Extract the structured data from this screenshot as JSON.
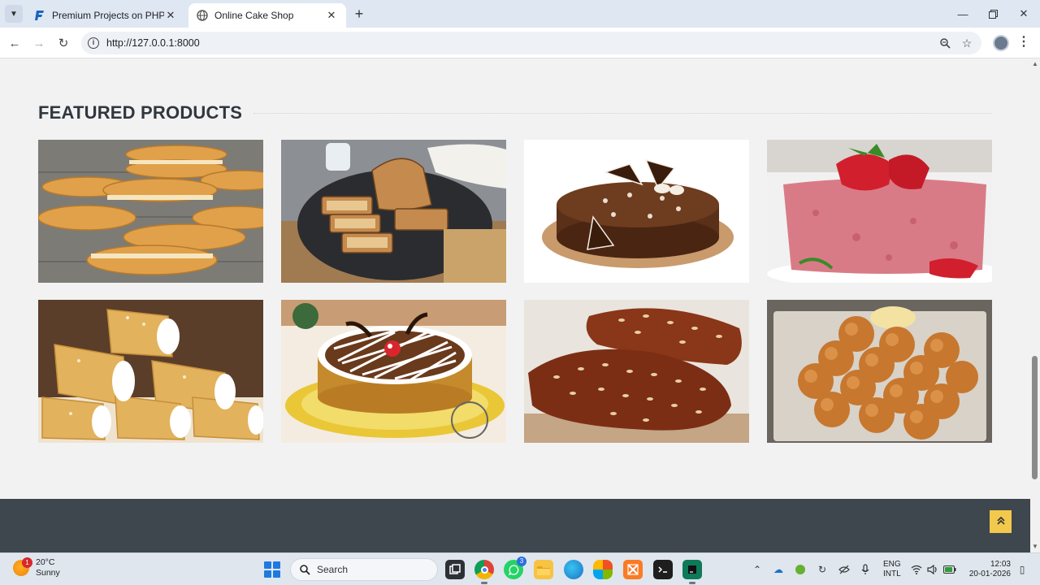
{
  "browser": {
    "tabs": [
      {
        "title": "Premium Projects on PHP, Java",
        "active": false
      },
      {
        "title": "Online Cake Shop",
        "active": true
      }
    ],
    "new_tab_label": "+",
    "url": "http://127.0.0.1:8000"
  },
  "page": {
    "section_title": "FEATURED PRODUCTS",
    "products": [
      {
        "image": "cream-biscuits"
      },
      {
        "image": "sliced-banana-bread"
      },
      {
        "image": "chocolate-decor-cake"
      },
      {
        "image": "strawberry-sponge-cake"
      },
      {
        "image": "cream-rolls"
      },
      {
        "image": "black-forest-cake"
      },
      {
        "image": "oat-topped-bread"
      },
      {
        "image": "dinner-rolls"
      }
    ],
    "back_to_top_icon": "double-chevron-up-icon"
  },
  "taskbar": {
    "weather": {
      "temp": "20°C",
      "condition": "Sunny",
      "badge": "1"
    },
    "search_label": "Search",
    "whatsapp_badge": "3",
    "language_line1": "ENG",
    "language_line2": "INTL",
    "time": "12:03",
    "date": "20-01-2026"
  },
  "colors": {
    "page_bg": "#f2f2f2",
    "heading": "#2f3740",
    "footer_bg": "#3e474d",
    "back_to_top": "#f2c94c"
  }
}
